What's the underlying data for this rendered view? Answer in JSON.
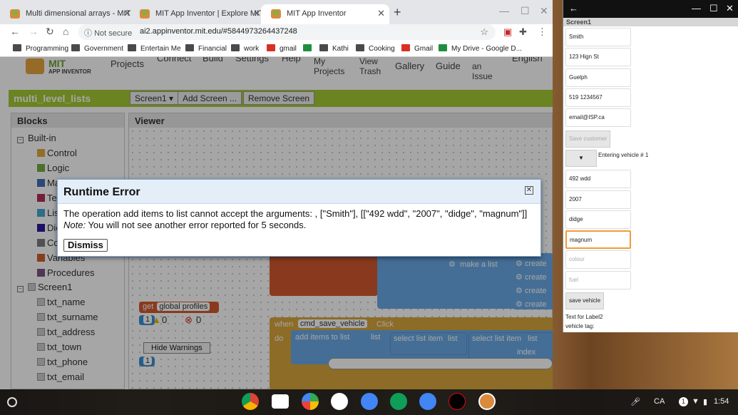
{
  "browser": {
    "tabs": [
      {
        "title": "Multi dimensional arrays - MIT Ap",
        "active": false
      },
      {
        "title": "MIT App Inventor | Explore MIT Ap",
        "active": false
      },
      {
        "title": "MIT App Inventor",
        "active": true
      }
    ],
    "new_tab_icon": "+",
    "address": {
      "security": "Not secure",
      "url": "ai2.appinventor.mit.edu/#5844973264437248"
    },
    "bookmarks": [
      {
        "label": "Programming",
        "icon": "folder"
      },
      {
        "label": "Government",
        "icon": "folder"
      },
      {
        "label": "Entertain Me",
        "icon": "folder"
      },
      {
        "label": "Financial",
        "icon": "folder"
      },
      {
        "label": "work",
        "icon": "folder"
      },
      {
        "label": "gmail",
        "icon": "gmail"
      },
      {
        "label": "Kathi",
        "icon": "folder"
      },
      {
        "label": "Cooking",
        "icon": "folder"
      },
      {
        "label": "Gmail",
        "icon": "gmail"
      },
      {
        "label": "My Drive - Google D...",
        "icon": "drive"
      }
    ]
  },
  "app_inventor": {
    "logo_line1": "MIT",
    "logo_line2": "APP INVENTOR",
    "menu": {
      "projects": "Projects",
      "connect": "Connect",
      "build": "Build",
      "settings": "Settings",
      "help": "Help",
      "my_projects_1": "My",
      "my_projects_2": "Projects",
      "view_trash_1": "View",
      "view_trash_2": "Trash",
      "gallery": "Gallery",
      "guide": "Guide",
      "report_issue_2": "an",
      "report_issue_3": "Issue",
      "language": "English"
    },
    "project_name": "multi_level_lists",
    "screen_select": "Screen1 ▾",
    "add_screen": "Add Screen ...",
    "remove_screen": "Remove Screen",
    "blocks_title": "Blocks",
    "viewer_title": "Viewer",
    "tree": {
      "builtin": "Built-in",
      "categories": [
        {
          "label": "Control",
          "color": "#e1a93b"
        },
        {
          "label": "Logic",
          "color": "#77ab41"
        },
        {
          "label": "Math",
          "color": "#3f71b5"
        },
        {
          "label": "Text",
          "color": "#b32d5e"
        },
        {
          "label": "Lists",
          "color": "#49a6d4"
        },
        {
          "label": "Dictionaries",
          "color": "#2d1799"
        },
        {
          "label": "Colors",
          "color": "#7d7d7d"
        },
        {
          "label": "Variables",
          "color": "#d05f2d"
        },
        {
          "label": "Procedures",
          "color": "#7c5385"
        }
      ],
      "screen": "Screen1",
      "components": [
        "txt_name",
        "txt_surname",
        "txt_address",
        "txt_town",
        "txt_phone",
        "txt_email"
      ]
    },
    "blocks": {
      "make_a_list": "make a list",
      "create": "create",
      "get": "get",
      "global_profiles": "global profiles",
      "index_1": "1",
      "warnings_count": "0",
      "errors_count": "0",
      "hide_warnings": "Hide Warnings",
      "when": "when",
      "event_component": "cmd_save_vehicle",
      "click": "Click",
      "do": "do",
      "add_items_to_list": "add items to list",
      "list": "list",
      "select_list_item_1": "select list item",
      "select_list_item_2": "select list item",
      "index": "index",
      "index_2": "1"
    }
  },
  "dialog": {
    "title": "Runtime Error",
    "message": "The operation add items to list cannot accept the arguments: , [\"Smith\"], [[\"492 wdd\", \"2007\", \"didge\", \"magnum\"]]",
    "note_label": "Note:",
    "note_text": " You will not see another error reported for 5 seconds.",
    "dismiss": "Dismiss",
    "close_glyph": "✕"
  },
  "emulator": {
    "screen_title": "Screen1",
    "fields": [
      {
        "value": "Smith",
        "placeholder": false,
        "focused": false
      },
      {
        "value": "123 Hign St",
        "placeholder": false,
        "focused": false
      },
      {
        "value": "Guelph",
        "placeholder": false,
        "focused": false
      },
      {
        "value": "519 1234567",
        "placeholder": false,
        "focused": false
      },
      {
        "value": "email@ISP.ca",
        "placeholder": false,
        "focused": false
      }
    ],
    "save_customer": "Save customer",
    "entering_vehicle": "Entering vehicle # 1",
    "vehicle_fields": [
      {
        "value": "492 wdd",
        "placeholder": false,
        "focused": false
      },
      {
        "value": "2007",
        "placeholder": false,
        "focused": false
      },
      {
        "value": "didge",
        "placeholder": false,
        "focused": false
      },
      {
        "value": "magnum",
        "placeholder": false,
        "focused": true
      },
      {
        "value": "colour",
        "placeholder": true,
        "focused": false
      },
      {
        "value": "fuel",
        "placeholder": true,
        "focused": false
      }
    ],
    "save_vehicle": "save vehicle",
    "label2": "Text for Label2",
    "vehicle_tag": "vehicle tag:"
  },
  "shelf": {
    "apps": [
      "chrome-icon",
      "gmail-icon",
      "play-store-icon",
      "drive-icon",
      "docs-icon",
      "sheets-icon",
      "files-icon",
      "netflix-icon",
      "app-inventor-icon"
    ],
    "keyboard": "CA",
    "notifications": "1",
    "time": "1:54"
  }
}
